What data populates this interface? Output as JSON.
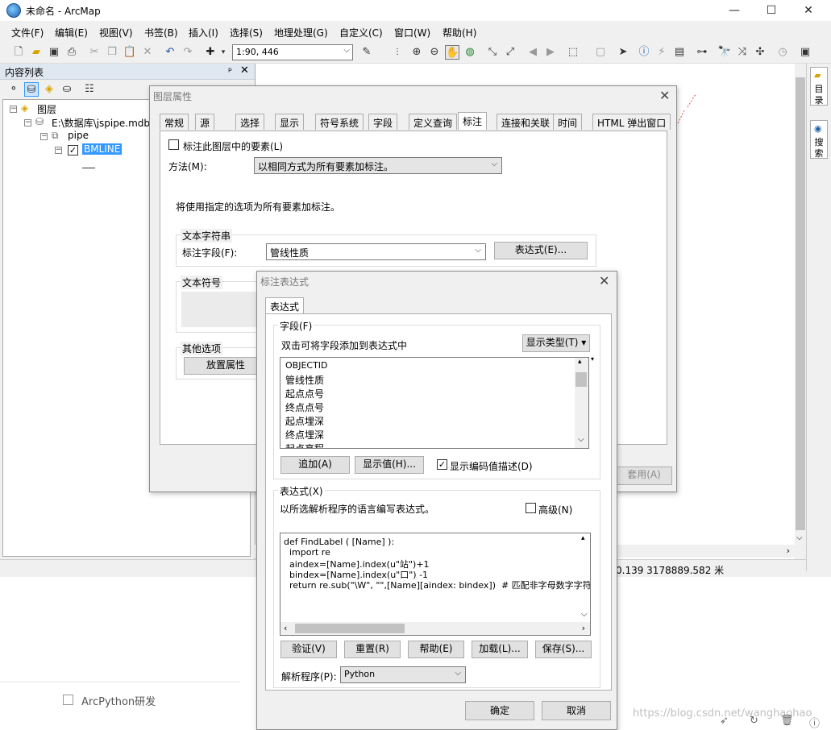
{
  "window": {
    "title": "未命名 - ArcMap",
    "min": "—",
    "max": "☐",
    "close": "✕"
  },
  "menu": [
    "文件(F)",
    "编辑(E)",
    "视图(V)",
    "书签(B)",
    "插入(I)",
    "选择(S)",
    "地理处理(G)",
    "自定义(C)",
    "窗口(W)",
    "帮助(H)"
  ],
  "toolbar": {
    "scale": "1:90, 446"
  },
  "toc": {
    "title": "内容列表",
    "pin": "ᵖ",
    "close": "✕",
    "root": "图层",
    "database": "E:\\数据库\\jspipe.mdb",
    "dataset": "pipe",
    "layer": "BMLINE"
  },
  "status": {
    "coords": "0.139  3178889.582 米"
  },
  "right_tabs": {
    "catalog": "目录",
    "search": "搜索"
  },
  "bottom": {
    "item": "ArcPython研发",
    "watermark": "https://blog.csdn.net/wanghaohao"
  },
  "layer_dialog": {
    "title": "图层属性",
    "tabs": [
      "常规",
      "源",
      "选择",
      "显示",
      "符号系统",
      "字段",
      "定义查询",
      "标注",
      "连接和关联",
      "时间",
      "HTML 弹出窗口"
    ],
    "active_tab": 7,
    "label_features": "标注此图层中的要素(L)",
    "method_label": "方法(M):",
    "method_value": "以相同方式为所有要素加标注。",
    "description": "将使用指定的选项为所有要素加标注。",
    "text_string_group": "文本字符串",
    "label_field_label": "标注字段(F):",
    "label_field_value": "管线性质",
    "expression_button": "表达式(E)...",
    "text_symbol_group": "文本符号",
    "other_options_group": "其他选项",
    "placement_button": "放置属性",
    "apply_button": "套用(A)"
  },
  "expr_dialog": {
    "title": "标注表达式",
    "tab": "表达式",
    "fields_group": "字段(F)",
    "fields_hint": "双击可将字段添加到表达式中",
    "show_types": "显示类型(T)",
    "fields": [
      "OBJECTID",
      "管线性质",
      "起点点号",
      "终点点号",
      "起点埋深",
      "终点埋深",
      "起点高程"
    ],
    "add_button": "追加(A)",
    "show_values_button": "显示值(H)...",
    "show_coded": "显示编码值描述(D)",
    "expression_group": "表达式(X)",
    "expression_hint": "以所选解析程序的语言编写表达式。",
    "advanced": "高级(N)",
    "code": [
      "def FindLabel ( [Name] ):",
      "  import re",
      "  aindex=[Name].index(u\"站\")+1",
      "  bindex=[Name].index(u\"口\") -1",
      "  return re.sub(\"\\W\", \"\",[Name][aindex: bindex])  # 匹配非字母数字字符"
    ],
    "verify_button": "验证(V)",
    "reset_button": "重置(R)",
    "help_button": "帮助(E)",
    "load_button": "加载(L)...",
    "save_button": "保存(S)...",
    "parser_label": "解析程序(P):",
    "parser_value": "Python",
    "ok_button": "确定",
    "cancel_button": "取消"
  }
}
